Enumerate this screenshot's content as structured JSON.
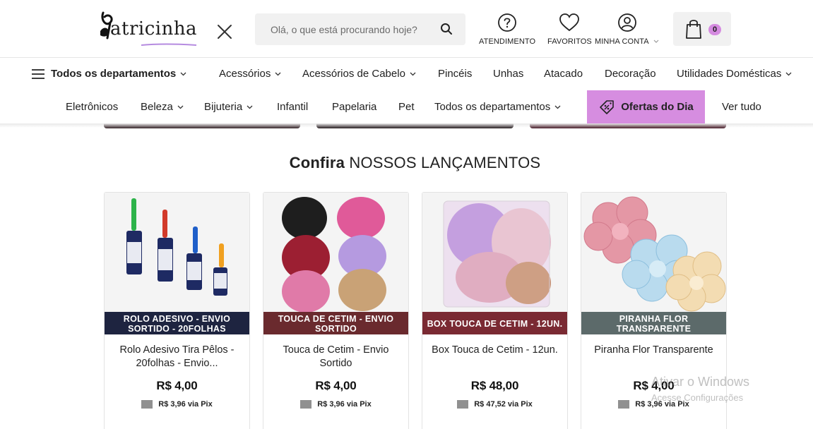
{
  "header": {
    "logo_text": "atricinha",
    "search_placeholder": "Olá, o que está procurando hoje?",
    "actions": [
      {
        "label": "ATENDIMENTO",
        "icon": "question-circle-icon"
      },
      {
        "label": "FAVORITOS",
        "icon": "heart-icon"
      },
      {
        "label": "MINHA CONTA",
        "icon": "user-circle-icon"
      }
    ],
    "cart_count": "0"
  },
  "nav": {
    "row1": [
      {
        "label": "Todos os departamentos",
        "dropdown": true
      },
      {
        "label": "Acessórios",
        "dropdown": true
      },
      {
        "label": "Acessórios de Cabelo",
        "dropdown": true
      },
      {
        "label": "Pincéis",
        "dropdown": false
      },
      {
        "label": "Unhas",
        "dropdown": false
      },
      {
        "label": "Atacado",
        "dropdown": false
      },
      {
        "label": "Decoração",
        "dropdown": false
      },
      {
        "label": "Utilidades Domésticas",
        "dropdown": true
      }
    ],
    "row2": [
      {
        "label": "Eletrônicos",
        "dropdown": false
      },
      {
        "label": "Beleza",
        "dropdown": true
      },
      {
        "label": "Bijuteria",
        "dropdown": true
      },
      {
        "label": "Infantil",
        "dropdown": false
      },
      {
        "label": "Papelaria",
        "dropdown": false
      },
      {
        "label": "Pet",
        "dropdown": false
      },
      {
        "label": "Todos os departamentos",
        "dropdown": true
      }
    ],
    "offers_label": "Ofertas do Dia",
    "see_all_label": "Ver tudo"
  },
  "section": {
    "title_bold": "Confira",
    "title_rest": "NOSSOS LANÇAMENTOS"
  },
  "products": [
    {
      "band": "ROLO ADESIVO - ENVIO SORTIDO - 20FOLHAS",
      "band_color": "#1e2440",
      "name": "Rolo Adesivo Tira Pêlos - 20folhas - Envio...",
      "price": "R$ 4,00",
      "pix": "R$ 3,96 via Pix"
    },
    {
      "band": "TOUCA DE CETIM - ENVIO SORTIDO",
      "band_color": "#6a2a2e",
      "name": "Touca de Cetim - Envio Sortido",
      "price": "R$ 4,00",
      "pix": "R$ 3,96 via Pix"
    },
    {
      "band": "BOX TOUCA DE CETIM - 12UN.",
      "band_color": "#7a2a33",
      "name": "Box Touca de Cetim - 12un.",
      "price": "R$ 48,00",
      "pix": "R$ 47,52 via Pix"
    },
    {
      "band": "PIRANHA FLOR TRANSPARENTE",
      "band_color": "#5c6a6a",
      "name": "Piranha Flor Transparente",
      "price": "R$ 4,00",
      "pix": "R$ 3,96 via Pix"
    }
  ],
  "watermark": {
    "line1": "Ativar o Windows",
    "line2": "Acesse Configurações"
  },
  "colors": {
    "accent": "#d68de0",
    "search_bg": "#f1f1f1"
  }
}
